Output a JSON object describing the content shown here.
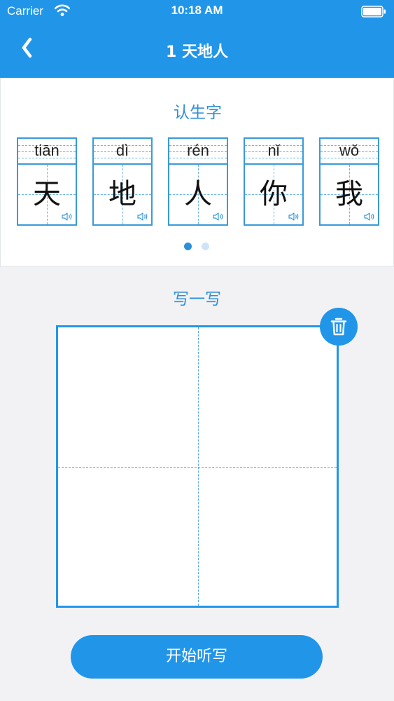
{
  "status_bar": {
    "carrier": "Carrier",
    "time": "10:18 AM",
    "icons": [
      "wifi-icon",
      "battery-icon"
    ]
  },
  "nav": {
    "back_icon": "chevron-left-icon",
    "title": "1 天地人"
  },
  "learn": {
    "title": "认生字",
    "cards": [
      {
        "pinyin": "tiān",
        "hanzi": "天"
      },
      {
        "pinyin": "dì",
        "hanzi": "地"
      },
      {
        "pinyin": "rén",
        "hanzi": "人"
      },
      {
        "pinyin": "nǐ",
        "hanzi": "你"
      },
      {
        "pinyin": "wǒ",
        "hanzi": "我"
      }
    ],
    "page_index": 1,
    "page_count": 2
  },
  "write": {
    "title": "写一写",
    "clear_icon": "trash-icon"
  },
  "actions": {
    "start_label": "开始听写"
  },
  "colors": {
    "primary": "#2196e9",
    "accent_text": "#2d8fd8",
    "background": "#f2f2f4"
  }
}
